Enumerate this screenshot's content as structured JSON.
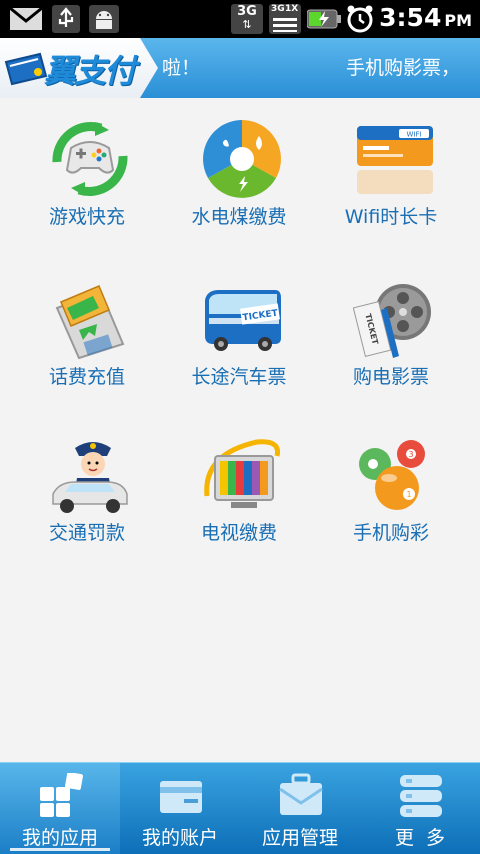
{
  "status_bar": {
    "time": "3:54",
    "ampm": "PM",
    "network_3g": "3G",
    "network_1x": "1X",
    "icons": [
      "mail-icon",
      "usb-icon",
      "android-debug-icon",
      "signal-3g-icon",
      "signal-1x-icon",
      "battery-charging-icon",
      "alarm-clock-icon"
    ]
  },
  "header": {
    "logo": "翼支付",
    "ticker_left": "啦！",
    "ticker_right": "手机购影票，"
  },
  "grid": {
    "items": [
      {
        "label": "游戏快充",
        "icon": "gamepad-icon"
      },
      {
        "label": "水电煤缴费",
        "icon": "utilities-icon"
      },
      {
        "label": "Wifi时长卡",
        "icon": "wifi-card-icon"
      },
      {
        "label": "话费充值",
        "icon": "phone-recharge-icon"
      },
      {
        "label": "长途汽车票",
        "icon": "bus-ticket-icon"
      },
      {
        "label": "购电影票",
        "icon": "movie-ticket-icon"
      },
      {
        "label": "交通罚款",
        "icon": "traffic-police-icon"
      },
      {
        "label": "电视缴费",
        "icon": "tv-icon"
      },
      {
        "label": "手机购彩",
        "icon": "lottery-balls-icon"
      }
    ]
  },
  "nav": {
    "items": [
      {
        "label": "我的应用",
        "icon": "apps-grid-icon",
        "active": true
      },
      {
        "label": "我的账户",
        "icon": "wallet-icon",
        "active": false
      },
      {
        "label": "应用管理",
        "icon": "briefcase-icon",
        "active": false
      },
      {
        "label": "更  多",
        "icon": "more-list-icon",
        "active": false
      }
    ]
  },
  "colors": {
    "header_blue": "#2a8fd6",
    "label_blue": "#1a6fb4",
    "nav_blue": "#0d6fb8"
  }
}
